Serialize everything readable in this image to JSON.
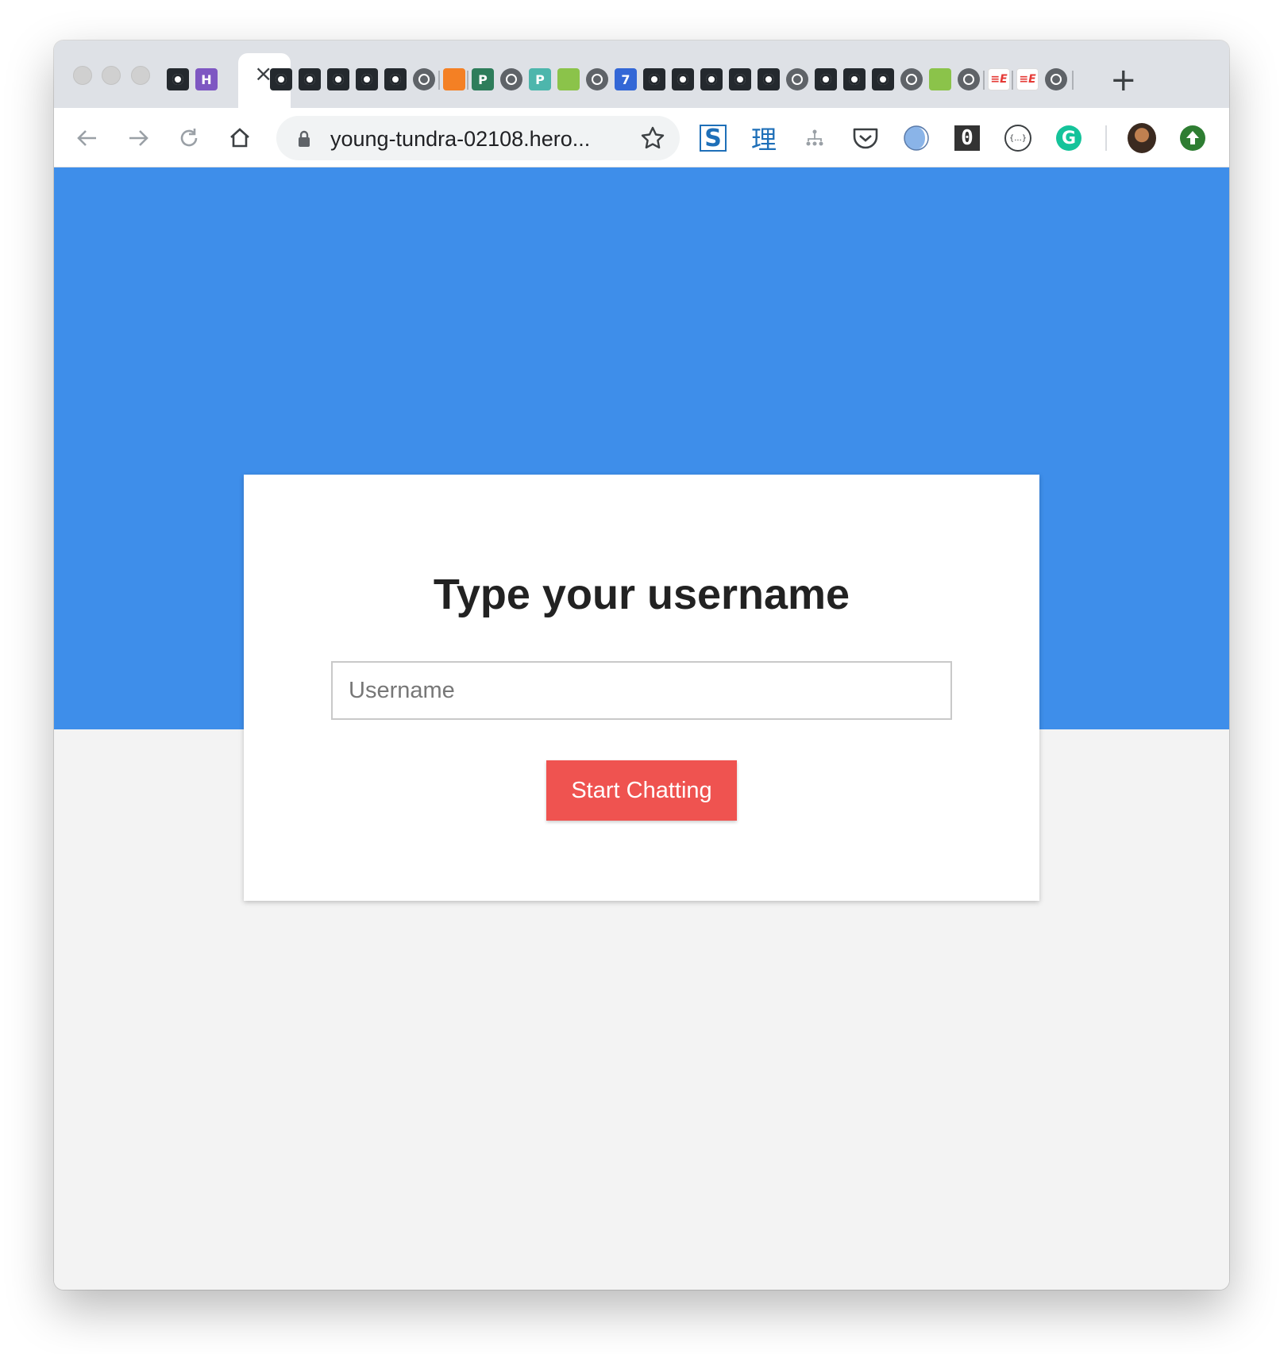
{
  "browser": {
    "active_tab_close": "×",
    "new_tab": "+",
    "address_bar": {
      "url": "young-tundra-02108.hero..."
    },
    "extension_glyphs": {
      "s_icon": "S",
      "li_icon": "理",
      "zero_icon": "0",
      "braces_icon": "{...}",
      "g_icon": "G",
      "p_icon": "P",
      "seven_icon": "7",
      "h_icon": "H"
    }
  },
  "page": {
    "colors": {
      "hero": "#3e8eea",
      "background": "#f3f3f3",
      "button": "#ef5350"
    },
    "card": {
      "title": "Type your username",
      "input_placeholder": "Username",
      "input_value": "",
      "button_label": "Start Chatting"
    }
  }
}
